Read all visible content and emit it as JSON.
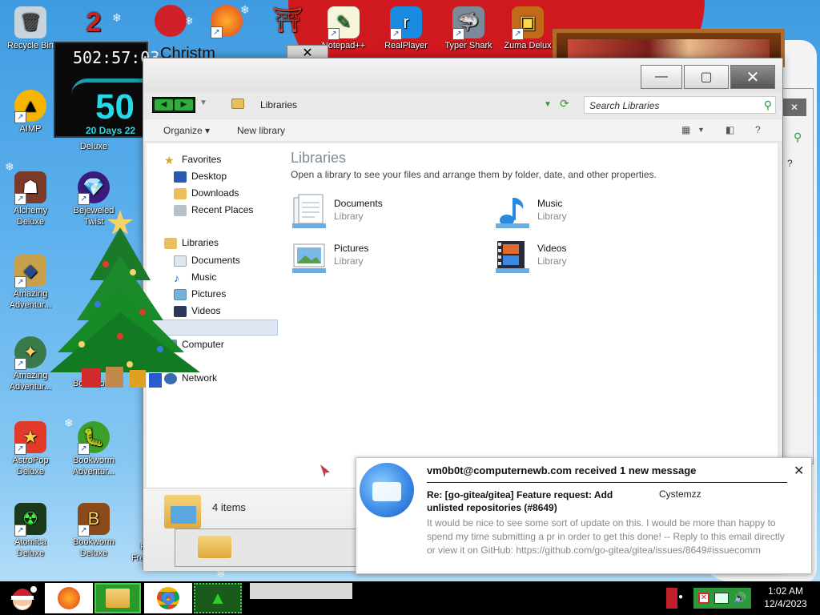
{
  "colors": {
    "desktop_sky": "#5fb2ee",
    "window_chrome": "#e9e9e9",
    "selection": "#dfe7f3",
    "nav_green": "#2fae3c",
    "gadget_cyan": "#27d8e8",
    "taskbar": "#000000"
  },
  "desktop": {
    "icons": [
      {
        "label": "Recycle Bin",
        "icon": "recycle-bin-icon"
      },
      {
        "label": "AIMP",
        "icon": "aimp-icon"
      },
      {
        "label": "Alchemy Deluxe",
        "icon": "alchemy-icon"
      },
      {
        "label": "Amazing Adventur...",
        "icon": "amazing-adventures-icon"
      },
      {
        "label": "Amazing Adventur...",
        "icon": "amazing-adventures-2-icon"
      },
      {
        "label": "AstroPop Deluxe",
        "icon": "astropop-icon"
      },
      {
        "label": "Atomica Deluxe",
        "icon": "atomica-icon"
      },
      {
        "label": "Bejeweled Twist",
        "icon": "bejeweled-icon"
      },
      {
        "label": "Bookworm Adventur...",
        "icon": "bookworm-adventures-icon"
      },
      {
        "label": "Bookworm Deluxe",
        "icon": "bookworm-icon"
      },
      {
        "label": "Feeding Frenzy Del...",
        "icon": "feeding-frenzy-icon"
      },
      {
        "label": "Deluxe",
        "icon": "deluxe-icon"
      },
      {
        "label": "Bookstor...",
        "icon": "bookstore-icon"
      },
      {
        "label": "Notepad++",
        "icon": "notepad-icon"
      },
      {
        "label": "RealPlayer",
        "icon": "realplayer-icon"
      },
      {
        "label": "Typer Shark",
        "icon": "typer-shark-icon"
      },
      {
        "label": "Zuma Delux",
        "icon": "zuma-icon"
      }
    ]
  },
  "gadget": {
    "time": "502:57:03",
    "big": "50",
    "days": "20 Days 22",
    "title": "Christm"
  },
  "explorer": {
    "breadcrumb": "Libraries",
    "search_placeholder": "Search Libraries",
    "toolbar": {
      "organize": "Organize ▾",
      "new_library": "New library"
    },
    "nav": {
      "favorites": "Favorites",
      "desktop": "Desktop",
      "downloads": "Downloads",
      "recent": "Recent Places",
      "libraries": "Libraries",
      "documents": "Documents",
      "music": "Music",
      "pictures": "Pictures",
      "videos": "Videos",
      "computer": "Computer",
      "network": "Network"
    },
    "heading": "Libraries",
    "subheading": "Open a library to see your files and arrange them by folder, date, and other properties.",
    "libraries": [
      {
        "name": "Documents",
        "kind": "Library"
      },
      {
        "name": "Music",
        "kind": "Library"
      },
      {
        "name": "Pictures",
        "kind": "Library"
      },
      {
        "name": "Videos",
        "kind": "Library"
      }
    ],
    "item_count": "4 items"
  },
  "notification": {
    "header": "vm0b0t@computernewb.com received 1 new message",
    "subject": "Re: [go-gitea/gitea] Feature request: Add unlisted repositories (#8649)",
    "from": "Cystemzz",
    "body": "It would be nice to see some sort of update on this. I would be more than happy to spend my time submitting a pr in order to get this done! -- Reply to this email directly or view it on GitHub: https://github.com/go-gitea/gitea/issues/8649#issuecomm"
  },
  "taskbar": {
    "time": "1:02 AM",
    "date": "12/4/2023"
  }
}
